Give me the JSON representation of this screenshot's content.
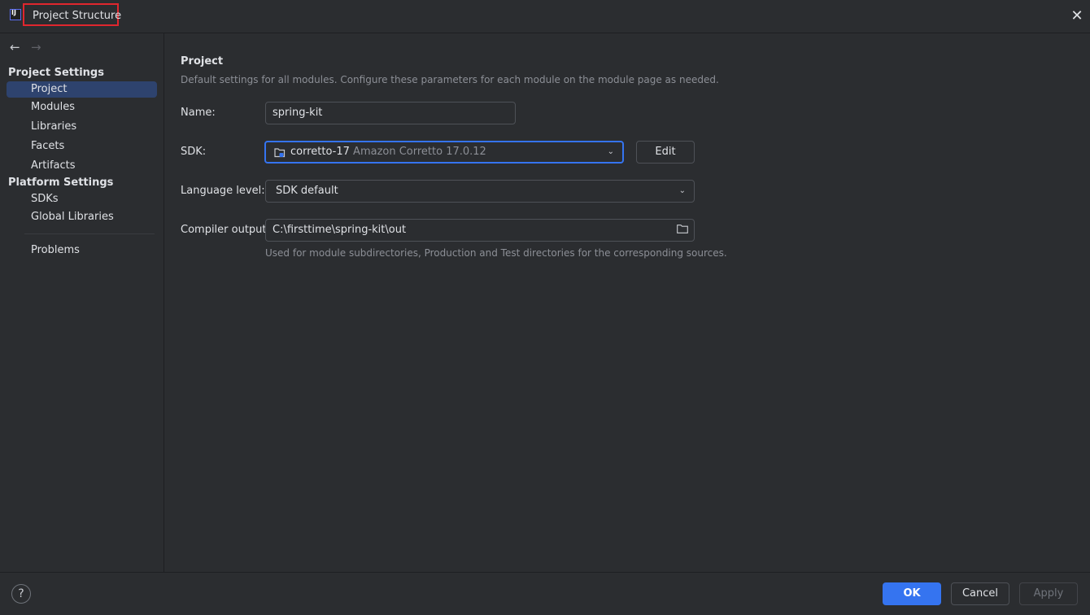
{
  "window": {
    "title": "Project Structure",
    "logo_text": "IJ",
    "close_icon": "✕"
  },
  "sidebar": {
    "back_icon": "←",
    "forward_icon": "→",
    "project_settings_header": "Project Settings",
    "project_settings_items": [
      {
        "label": "Project",
        "selected": true
      },
      {
        "label": "Modules"
      },
      {
        "label": "Libraries"
      },
      {
        "label": "Facets"
      },
      {
        "label": "Artifacts"
      }
    ],
    "platform_settings_header": "Platform Settings",
    "platform_settings_items": [
      {
        "label": "SDKs"
      },
      {
        "label": "Global Libraries"
      }
    ],
    "problems": "Problems"
  },
  "main": {
    "title": "Project",
    "description": "Default settings for all modules. Configure these parameters for each module on the module page as needed.",
    "name_label": "Name:",
    "name_value": "spring-kit",
    "sdk_label": "SDK:",
    "sdk_value": "corretto-17",
    "sdk_detail": "Amazon Corretto 17.0.12",
    "edit_button": "Edit",
    "language_level_label": "Language level:",
    "language_level_value": "SDK default",
    "compiler_output_label": "Compiler output:",
    "compiler_output_value": "C:\\firsttime\\spring-kit\\out",
    "compiler_output_hint": "Used for module subdirectories, Production and Test directories for the corresponding sources.",
    "accent_color": "#3574f0"
  },
  "footer": {
    "help": "?",
    "ok": "OK",
    "cancel": "Cancel",
    "apply": "Apply"
  }
}
